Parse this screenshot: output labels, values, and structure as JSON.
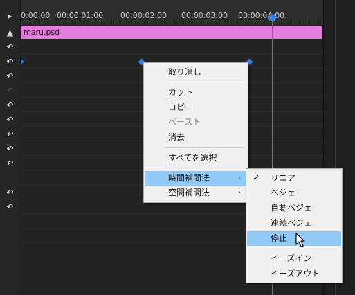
{
  "ruler": {
    "labels": [
      "0:00:00",
      "00:00:01:00",
      "00:00:02:00",
      "00:00:03:00",
      "00:00:04:00"
    ]
  },
  "clip": {
    "name": "maru.psd",
    "color": "#e37ddc"
  },
  "playhead_color": "#3c82d8",
  "gutter": {
    "top_icon": "▲",
    "reset_icon": "↶"
  },
  "context_menu": {
    "items": [
      {
        "label": "取り消し",
        "enabled": true
      },
      {
        "label": "カット",
        "enabled": true
      },
      {
        "label": "コピー",
        "enabled": true
      },
      {
        "label": "ペースト",
        "enabled": false
      },
      {
        "label": "消去",
        "enabled": true
      },
      {
        "label": "すべてを選択",
        "enabled": true
      },
      {
        "label": "時間補間法",
        "enabled": true,
        "submenu": true,
        "highlighted": true
      },
      {
        "label": "空間補間法",
        "enabled": true,
        "submenu": true
      }
    ],
    "submenu_arrow": "›"
  },
  "submenu": {
    "check_mark": "✓",
    "items": [
      {
        "label": "リニア",
        "checked": true
      },
      {
        "label": "ベジェ"
      },
      {
        "label": "自動ベジェ"
      },
      {
        "label": "連続ベジェ"
      },
      {
        "label": "停止",
        "highlighted": true
      },
      {
        "label": "イーズイン"
      },
      {
        "label": "イーズアウト"
      }
    ]
  }
}
